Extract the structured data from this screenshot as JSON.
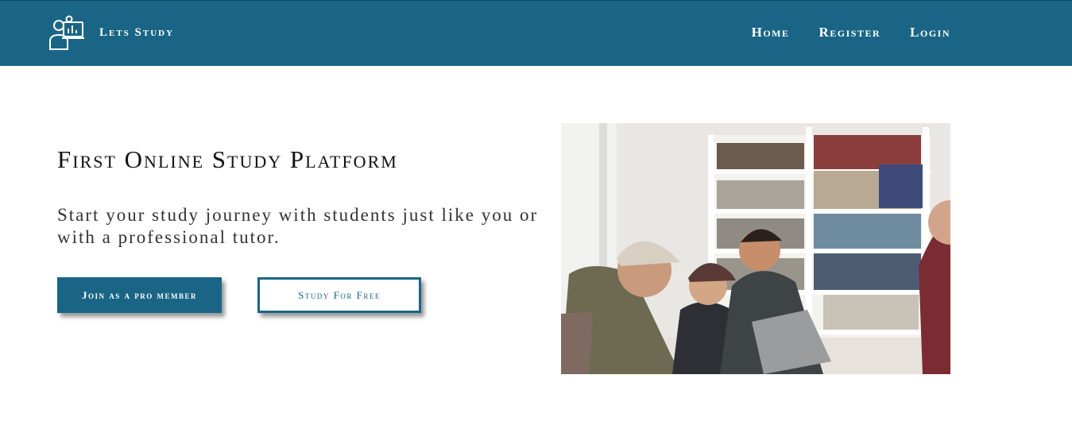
{
  "header": {
    "brand_name": "Lets Study",
    "logo_icon": "tutor-screen-icon",
    "nav": [
      {
        "label": "Home"
      },
      {
        "label": "Register"
      },
      {
        "label": "Login"
      }
    ]
  },
  "hero": {
    "title": "First Online Study Platform",
    "subtitle": "Start your study journey with students just like you or with a professional tutor.",
    "primary_button": "Join as a pro member",
    "secondary_button": "Study For Free",
    "image_alt": "students-laughing-at-laptops-photo"
  },
  "colors": {
    "brand": "#1a6586",
    "background": "#ffffff"
  }
}
